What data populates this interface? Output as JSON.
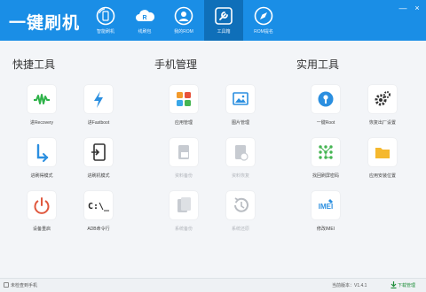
{
  "app": {
    "title": "一键刷机"
  },
  "nav": [
    {
      "label": "智能刷机",
      "icon": "refresh-phone-icon"
    },
    {
      "label": "线刷包",
      "icon": "cloud-r-icon"
    },
    {
      "label": "我的ROM",
      "icon": "user-icon"
    },
    {
      "label": "工具箱",
      "icon": "wrench-icon"
    },
    {
      "label": "ROM提名",
      "icon": "compass-icon"
    }
  ],
  "window_controls": {
    "minimize": "—",
    "close": "×"
  },
  "sections": {
    "quick": {
      "title": "快捷工具",
      "tiles": [
        {
          "label": "进Recovery"
        },
        {
          "label": "进Fastboot"
        },
        {
          "label": "进刷得模式"
        },
        {
          "label": "进刷机模式"
        },
        {
          "label": "设备重启"
        },
        {
          "label": "ADB命令行"
        }
      ]
    },
    "phone": {
      "title": "手机管理",
      "tiles": [
        {
          "label": "应用管理"
        },
        {
          "label": "图片管理"
        },
        {
          "label": "资料备份"
        },
        {
          "label": "资料恢复"
        },
        {
          "label": "系统备份"
        },
        {
          "label": "系统还原"
        }
      ]
    },
    "utility": {
      "title": "实用工具",
      "tiles": [
        {
          "label": "一键Root"
        },
        {
          "label": "恢复出厂设置"
        },
        {
          "label": "找回刷屏密码"
        },
        {
          "label": "应用安装位置"
        },
        {
          "label": "修改IMEI",
          "icon_text": "IMEI"
        }
      ]
    }
  },
  "status": {
    "left": "未检查到手机",
    "version": "当前版本：V1.4.1",
    "download": "下载管理",
    "adb_prompt": "C:\\_"
  },
  "colors": {
    "brand": "#1a8ee6",
    "active_tab": "#0f6fb9"
  }
}
